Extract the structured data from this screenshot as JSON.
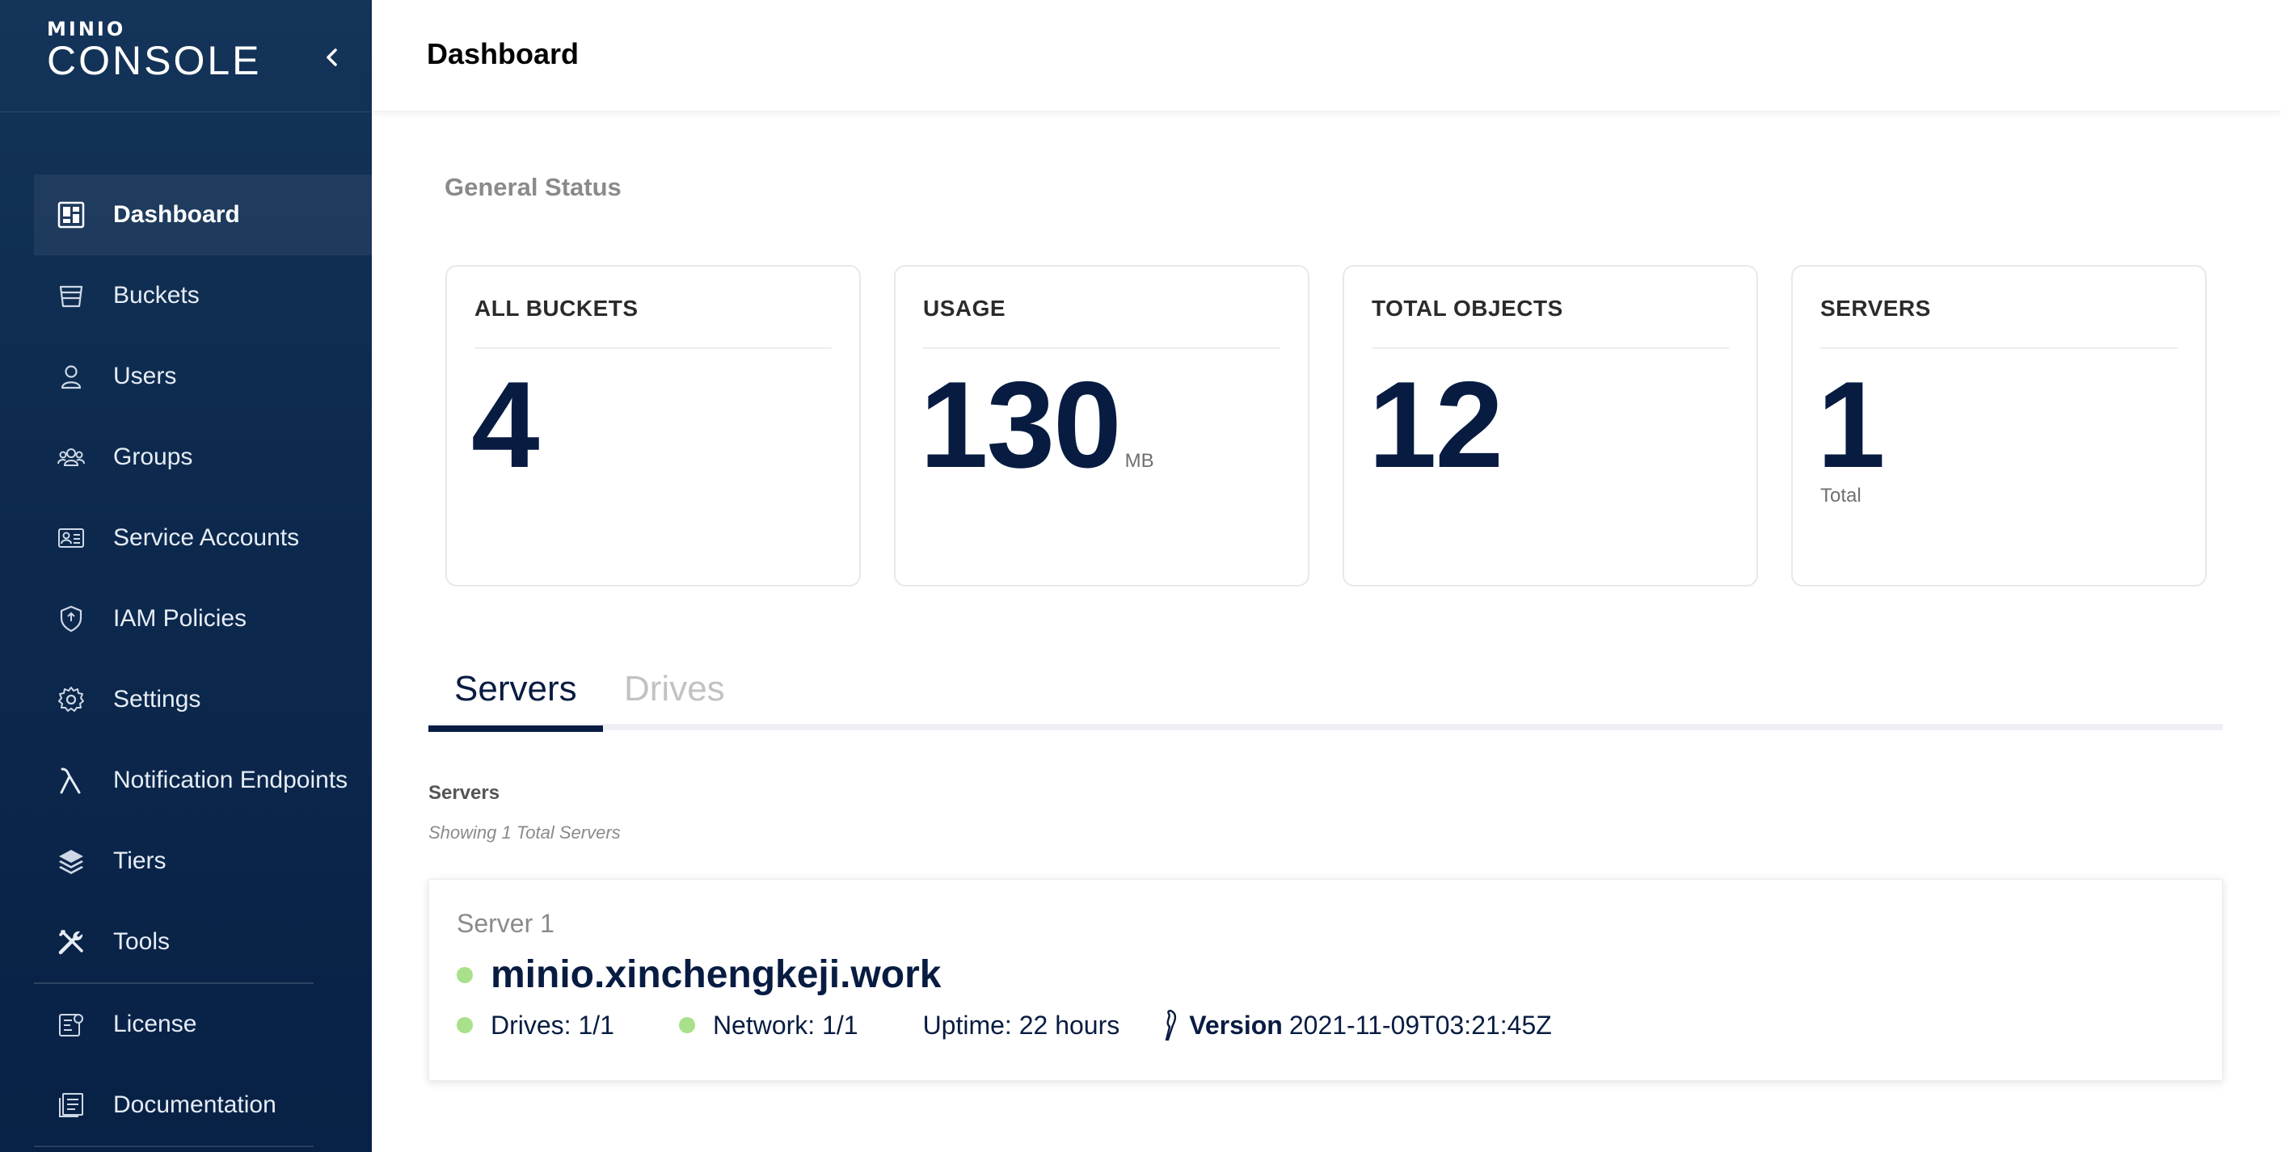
{
  "brand": {
    "top": "MINIO",
    "bottom": "CONSOLE"
  },
  "header": {
    "title": "Dashboard"
  },
  "sidebar": {
    "items": [
      {
        "label": "Dashboard",
        "icon": "dashboard-icon",
        "active": true
      },
      {
        "label": "Buckets",
        "icon": "bucket-icon"
      },
      {
        "label": "Users",
        "icon": "user-icon"
      },
      {
        "label": "Groups",
        "icon": "groups-icon"
      },
      {
        "label": "Service Accounts",
        "icon": "service-accounts-icon"
      },
      {
        "label": "IAM Policies",
        "icon": "shield-icon"
      },
      {
        "label": "Settings",
        "icon": "gear-icon"
      },
      {
        "label": "Notification Endpoints",
        "icon": "lambda-icon"
      },
      {
        "label": "Tiers",
        "icon": "layers-icon"
      },
      {
        "label": "Tools",
        "icon": "tools-icon"
      },
      {
        "label": "License",
        "icon": "license-icon"
      },
      {
        "label": "Documentation",
        "icon": "documentation-icon"
      }
    ]
  },
  "main": {
    "section_title": "General Status",
    "cards": [
      {
        "title": "ALL BUCKETS",
        "value": "4",
        "unit": "",
        "sub": ""
      },
      {
        "title": "USAGE",
        "value": "130",
        "unit": "MB",
        "sub": ""
      },
      {
        "title": "TOTAL OBJECTS",
        "value": "12",
        "unit": "",
        "sub": ""
      },
      {
        "title": "SERVERS",
        "value": "1",
        "unit": "",
        "sub": "Total"
      }
    ],
    "tabs": [
      {
        "label": "Servers",
        "active": true
      },
      {
        "label": "Drives",
        "active": false
      }
    ],
    "servers_heading": "Servers",
    "servers_subtitle": "Showing 1 Total Servers",
    "server": {
      "name": "Server 1",
      "host": "minio.xinchengkeji.work",
      "drives": "Drives: 1/1",
      "network": "Network: 1/1",
      "uptime": "Uptime: 22 hours",
      "version_label": "Version",
      "version_value": "2021-11-09T03:21:45Z"
    }
  },
  "colors": {
    "sidebar": "#0d2a4e",
    "accent": "#081c42",
    "status_ok": "#a9e08a"
  }
}
